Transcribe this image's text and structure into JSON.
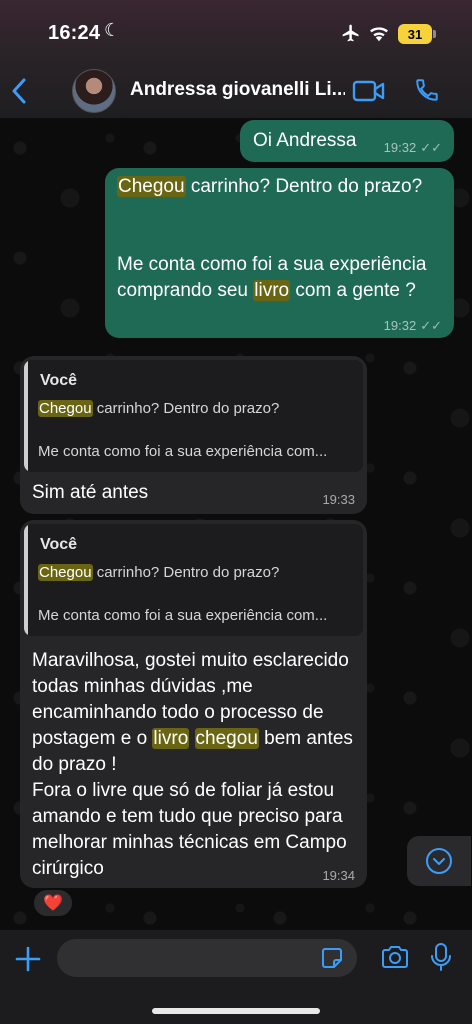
{
  "status_bar": {
    "time": "16:24",
    "battery": "31"
  },
  "header": {
    "contact_name": "Andressa giovanelli Li..."
  },
  "messages": [
    {
      "id": "m1",
      "direction": "outgoing",
      "text": "Oi Andressa",
      "time": "19:32"
    },
    {
      "id": "m2",
      "direction": "outgoing",
      "parts": [
        "Chegou",
        " carrinho? Dentro do prazo?",
        "Me conta como foi a sua experiência comprando seu ",
        "livro",
        " com a gente ?"
      ],
      "time": "19:32"
    },
    {
      "id": "m3",
      "direction": "incoming",
      "quote": {
        "author": "Você",
        "line1_hl": "Chegou",
        "line1_rest": " carrinho? Dentro do prazo?",
        "line2": "Me conta como foi a sua experiência com..."
      },
      "text": "Sim até antes",
      "time": "19:33"
    },
    {
      "id": "m4",
      "direction": "incoming",
      "quote": {
        "author": "Você",
        "line1_hl": "Chegou",
        "line1_rest": " carrinho? Dentro do prazo?",
        "line2": "Me conta como foi a sua experiência com..."
      },
      "parts": [
        "Maravilhosa, gostei muito esclarecido todas minhas dúvidas ,me encaminhando todo o processo de postagem e o ",
        "livro",
        "chegou",
        " bem antes do prazo !",
        "Fora o livre que só de foliar já estou amando e tem tudo que preciso para melhorar minhas técnicas em Campo cirúrgico"
      ],
      "time": "19:34",
      "reaction": "❤️"
    }
  ],
  "composer": {
    "placeholder": ""
  },
  "colors": {
    "outgoing_bubble": "#1f6a55",
    "incoming_bubble": "#262628",
    "highlight": "#6a6513",
    "accent_blue": "#3b9df8"
  },
  "icons": [
    "back-icon",
    "video-call-icon",
    "phone-call-icon",
    "scroll-down-icon",
    "plus-icon",
    "sticker-icon",
    "camera-icon",
    "microphone-icon"
  ]
}
